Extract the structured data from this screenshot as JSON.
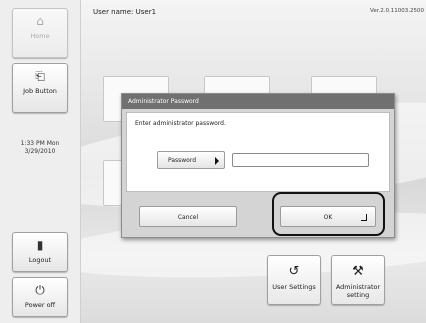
{
  "header": {
    "user_label": "User name: User1",
    "version": "Ver.2.0.11003.2500"
  },
  "sidebar": {
    "home": {
      "label": "Home",
      "icon": "home-icon",
      "glyph": "⌂"
    },
    "job_button": {
      "label": "Job Button",
      "icon": "job-icon",
      "glyph": "⎗"
    },
    "time": "1:33 PM  Mon",
    "date": "3/29/2010",
    "logout": {
      "label": "Logout",
      "icon": "logout-icon",
      "glyph": "▮"
    },
    "power_off": {
      "label": "Power off",
      "icon": "power-icon",
      "glyph": "⏻"
    }
  },
  "dialog": {
    "title": "Administrator Password",
    "prompt": "Enter administrator password.",
    "password_button": "Password",
    "password_value": "",
    "cancel": "Cancel",
    "ok": "OK"
  },
  "bottom": {
    "user_settings": {
      "label": "User Settings",
      "icon": "user-settings-icon",
      "glyph": "↺"
    },
    "admin_setting": {
      "label_line1": "Administrator",
      "label_line2": "setting",
      "icon": "admin-tools-icon",
      "glyph": "⚒"
    }
  },
  "colors": {
    "dialog_title_bg": "#707070",
    "highlight": "#111111"
  }
}
